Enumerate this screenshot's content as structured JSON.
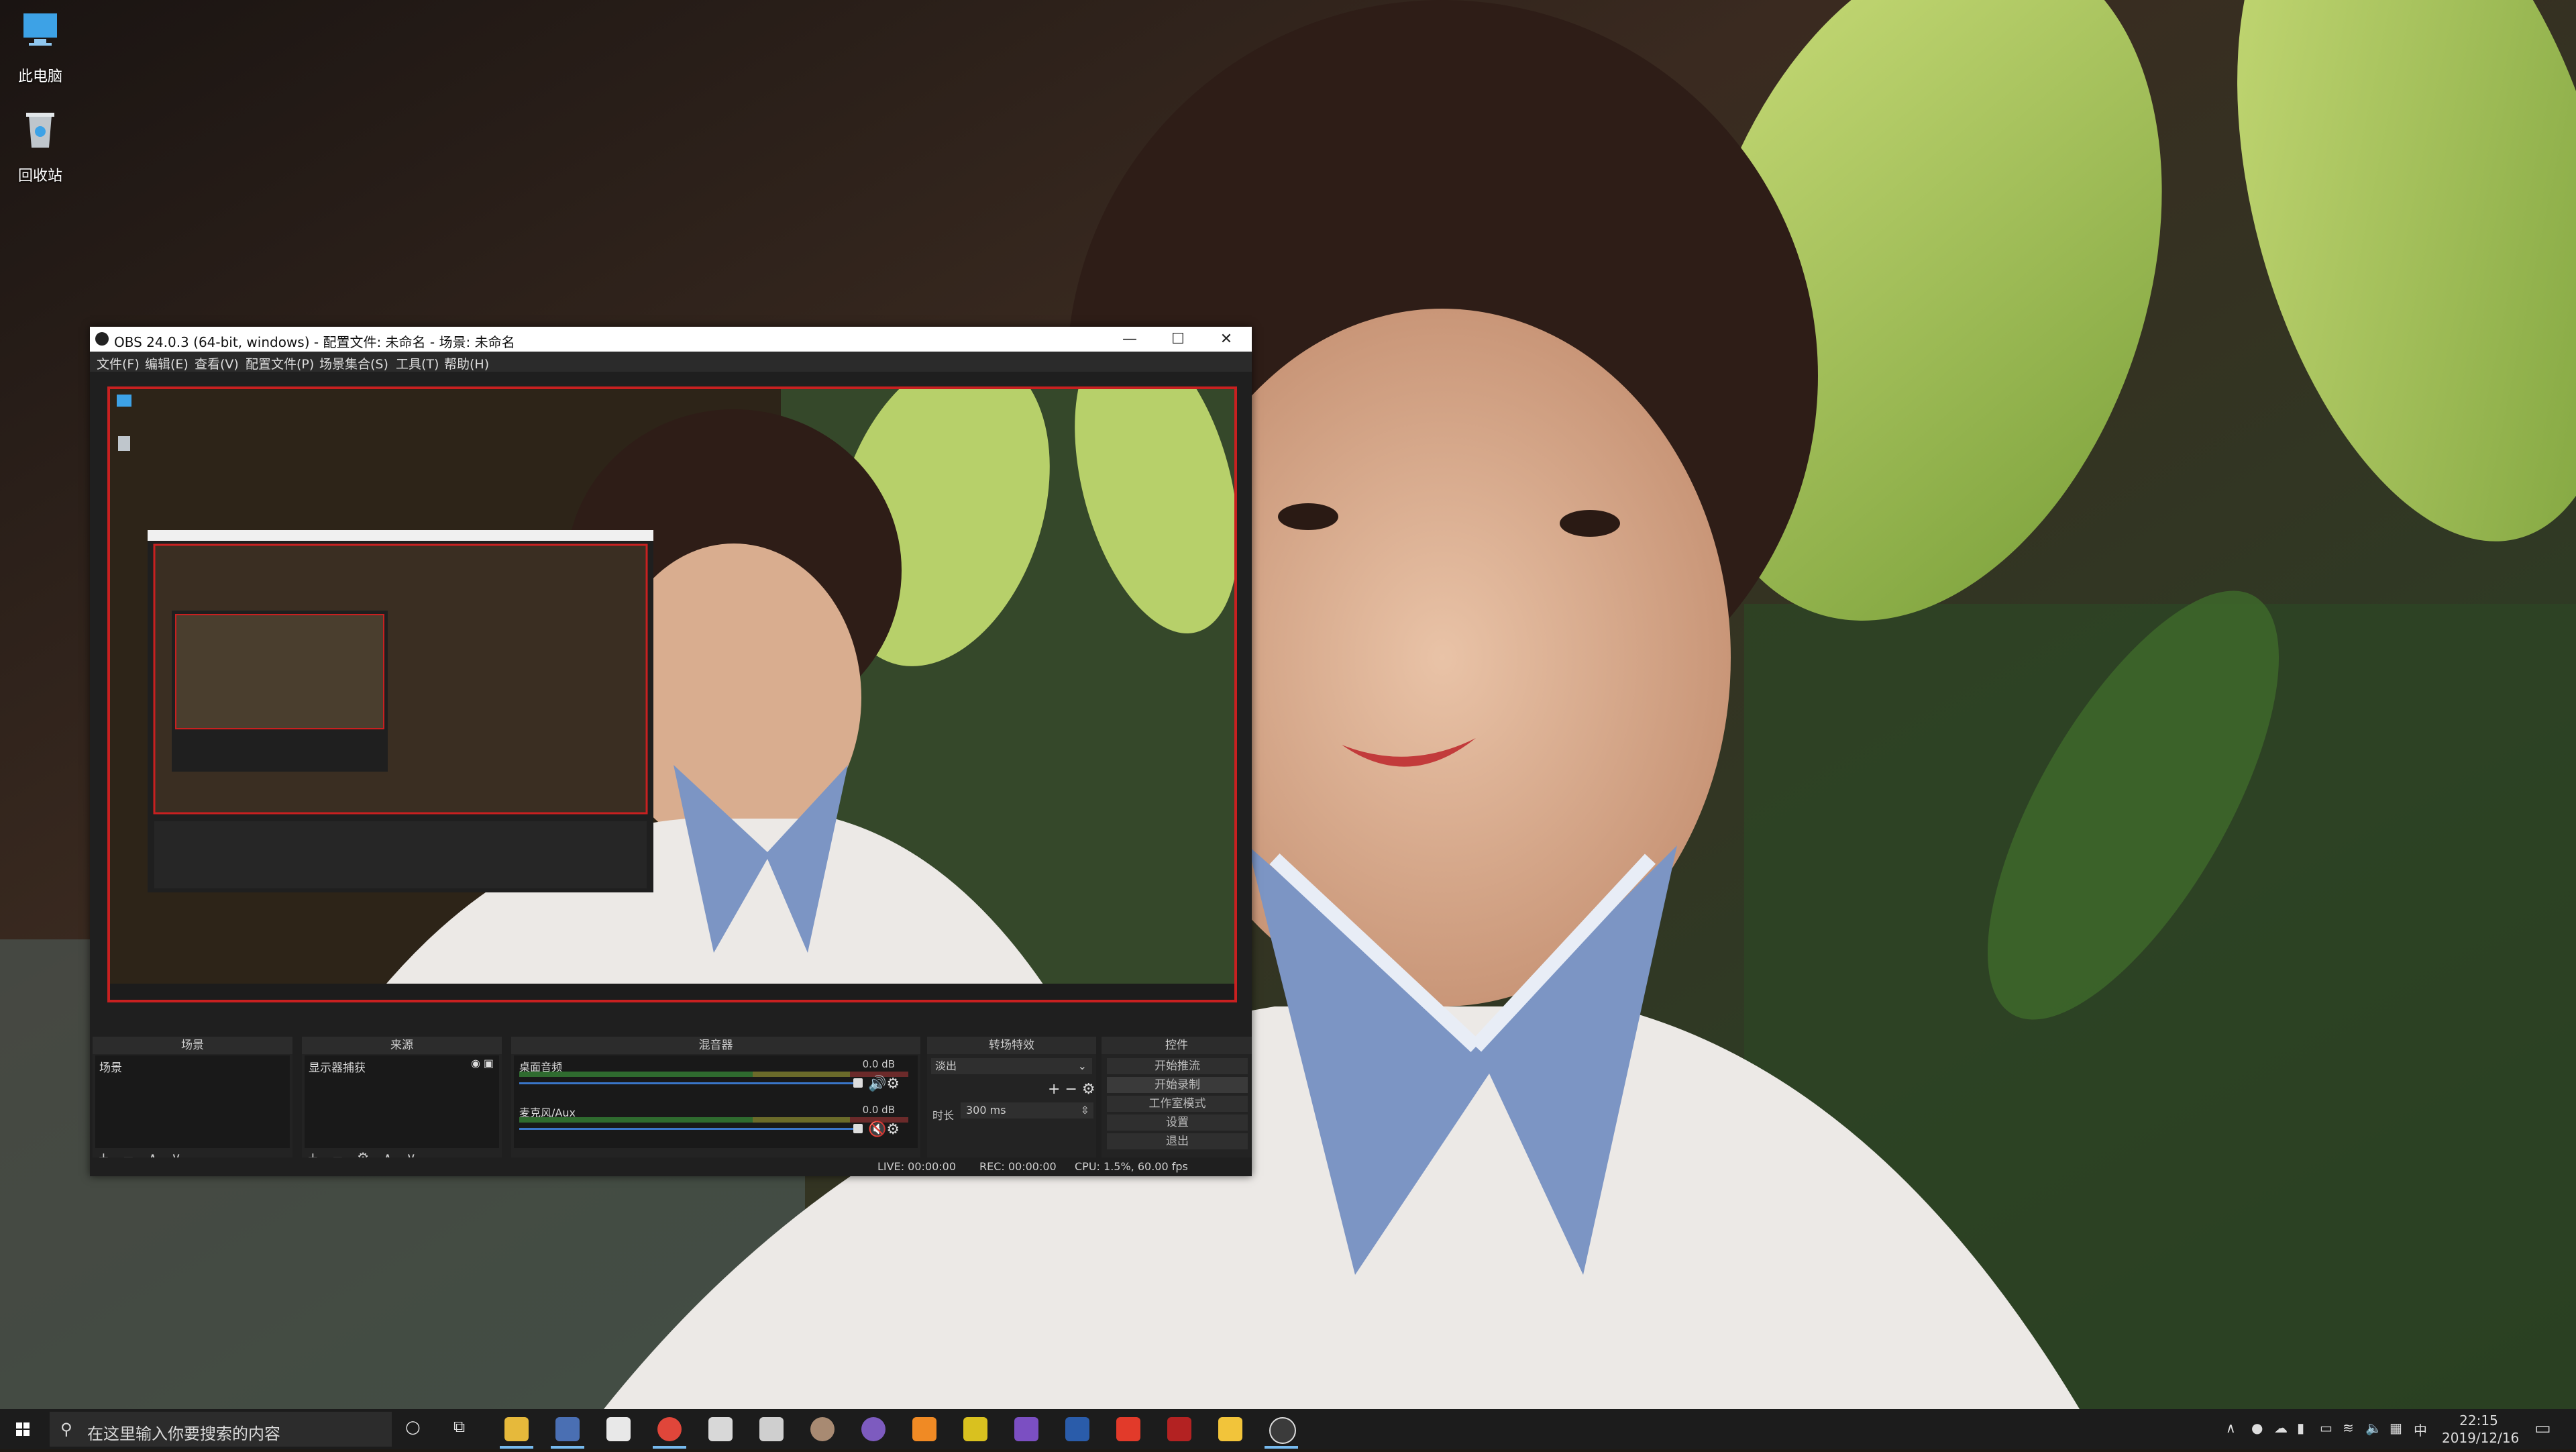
{
  "desktop": {
    "icons": [
      {
        "label": "此电脑",
        "icon": "this-pc-icon"
      },
      {
        "label": "回收站",
        "icon": "recycle-bin-icon"
      }
    ]
  },
  "obs": {
    "title": "OBS 24.0.3 (64-bit, windows) - 配置文件: 未命名 - 场景: 未命名",
    "window_buttons": {
      "minimize": "—",
      "maximize": "☐",
      "close": "✕"
    },
    "menu": [
      "文件(F)",
      "编辑(E)",
      "查看(V)",
      "配置文件(P)",
      "场景集合(S)",
      "工具(T)",
      "帮助(H)"
    ],
    "docks": {
      "scenes": {
        "title": "场景",
        "items": [
          "场景"
        ]
      },
      "sources": {
        "title": "来源",
        "items": [
          "显示器捕获"
        ]
      },
      "mixer": {
        "title": "混音器",
        "channels": [
          {
            "name": "桌面音频",
            "db": "0.0 dB"
          },
          {
            "name": "麦克风/Aux",
            "db": "0.0 dB"
          }
        ]
      },
      "transitions": {
        "title": "转场特效",
        "selected": "淡出",
        "duration_label": "时长",
        "duration_value": "300 ms"
      },
      "controls": {
        "title": "控件",
        "buttons": [
          "开始推流",
          "开始录制",
          "工作室模式",
          "设置",
          "退出"
        ]
      }
    },
    "status": {
      "live": "LIVE: 00:00:00",
      "rec": "REC: 00:00:00",
      "cpu": "CPU: 1.5%, 60.00 fps"
    }
  },
  "taskbar": {
    "search_placeholder": "在这里输入你要搜索的内容",
    "clock_time": "22:15",
    "clock_date": "2019/12/16",
    "ime": "中",
    "pinned_icons": [
      "cortana-icon",
      "task-view-icon",
      "file-explorer-icon",
      "save-icon",
      "mail-icon",
      "chrome-icon",
      "paw-icon",
      "calculator-icon",
      "avatar-app-icon",
      "github-icon",
      "sublime-icon",
      "folder-app-icon",
      "visual-studio-icon",
      "powershell-icon",
      "red-app-icon",
      "bug-app-icon",
      "python-icon",
      "obs-icon"
    ]
  },
  "colors": {
    "accent": "#3a76c9",
    "preview_border": "#c82020",
    "taskbar": "#1c1c1c",
    "obs_dark": "#1f1f1f"
  }
}
